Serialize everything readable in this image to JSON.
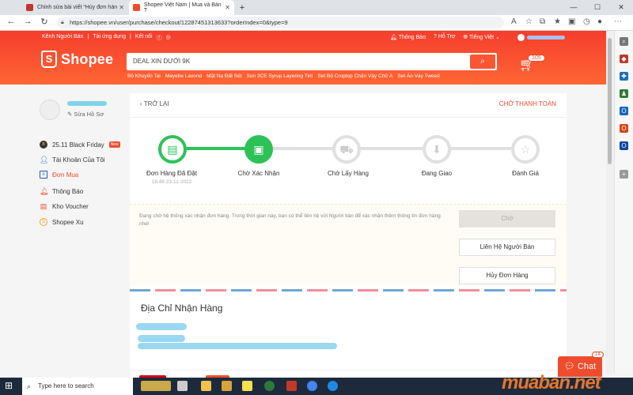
{
  "browser": {
    "tabs": [
      {
        "title": "Chỉnh sửa bài viết “Hủy đơn hàn"
      },
      {
        "title": "Shopee Việt Nam | Mua và Bán T"
      }
    ],
    "url": "https://shopee.vn/user/purchase/checkout/12287451313633?orderIndex=0&type=9"
  },
  "header": {
    "top_left": [
      "Kênh Người Bán",
      "|",
      "Tải ứng dụng",
      "|",
      "Kết nối"
    ],
    "notifications": "Thông Báo",
    "help": "Hỗ Trợ",
    "language": "Tiếng Việt",
    "logo": "Shopee",
    "search_placeholder": "DEAL XIN DƯỚI 9K",
    "cart_count": "105",
    "keywords": [
      "Bộ Khuyến Tai",
      "Mayebe Lavond",
      "Mặt Nạ Đất Sét",
      "Son 3CE Syrup Layering Tint",
      "Set Bộ Croptop Chân Váy Chữ A",
      "Set Áo Váy Tweed"
    ]
  },
  "sidebar": {
    "edit_profile": "Sửa Hồ Sơ",
    "items": [
      {
        "label": "25.11 Black Friday",
        "badge": "New"
      },
      {
        "label": "Tài Khoản Của Tôi"
      },
      {
        "label": "Đơn Mua"
      },
      {
        "label": "Thông Báo"
      },
      {
        "label": "Kho Voucher"
      },
      {
        "label": "Shopee Xu"
      }
    ]
  },
  "order": {
    "back": "TRỞ LẠI",
    "status": "CHỜ THANH TOÁN",
    "steps": [
      {
        "label": "Đơn Hàng Đã Đặt",
        "time": "18:48 23-11-2022",
        "state": "done"
      },
      {
        "label": "Chờ Xác Nhận",
        "time": "",
        "state": "current"
      },
      {
        "label": "Chờ Lấy Hàng",
        "time": "",
        "state": "todo"
      },
      {
        "label": "Đang Giao",
        "time": "",
        "state": "todo"
      },
      {
        "label": "Đánh Giá",
        "time": "",
        "state": "todo"
      }
    ],
    "notice": "Đang chờ hệ thống xác nhận đơn hàng. Trong thời gian này, bạn có thể liên hệ với Người bán để xác nhận thêm thông tin đơn hàng nhé!",
    "btn_wait": "Chờ",
    "btn_contact": "Liên Hệ Người Bán",
    "btn_cancel": "Hủy Đơn Hàng",
    "address_title": "Địa Chỉ Nhận Hàng"
  },
  "chat": {
    "label": "Chat",
    "badge": "14"
  },
  "taskbar": {
    "search": "Type here to search"
  },
  "watermark": "muaban.net",
  "colors": {
    "brand": "#ee4d2d",
    "step_done": "#2dc258"
  }
}
